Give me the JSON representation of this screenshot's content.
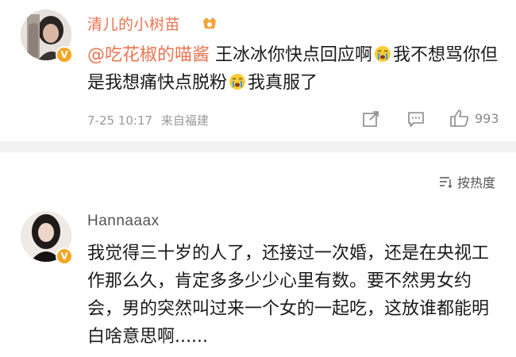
{
  "post": {
    "username": "清儿的小树苗",
    "mention": "@吃花椒的喵酱",
    "text_part1": " 王冰冰你快点回应啊",
    "text_part2": "我不想骂你但是我想痛快点脱粉",
    "text_part3": "我真服了",
    "timestamp": "7-25 10:17",
    "source": "来自福建",
    "like_count": "993",
    "emoji_names": [
      "crying-face-emoji",
      "crying-face-emoji"
    ]
  },
  "sort": {
    "label": "按热度"
  },
  "comment": {
    "username": "Hannaaax",
    "text": "我觉得三十岁的人了，还接过一次婚，还是在央视工作那么久，肯定多多少少心里有数。要不然男女约会，男的突然叫过来一个女的一起吃，这放谁都能明白啥意思啊......"
  },
  "colors": {
    "username_orange": "#eb7350",
    "username_gray": "#555555",
    "meta_gray": "#999999",
    "badge_yellow": "#f5a623",
    "separator": "#f2f2f2"
  }
}
